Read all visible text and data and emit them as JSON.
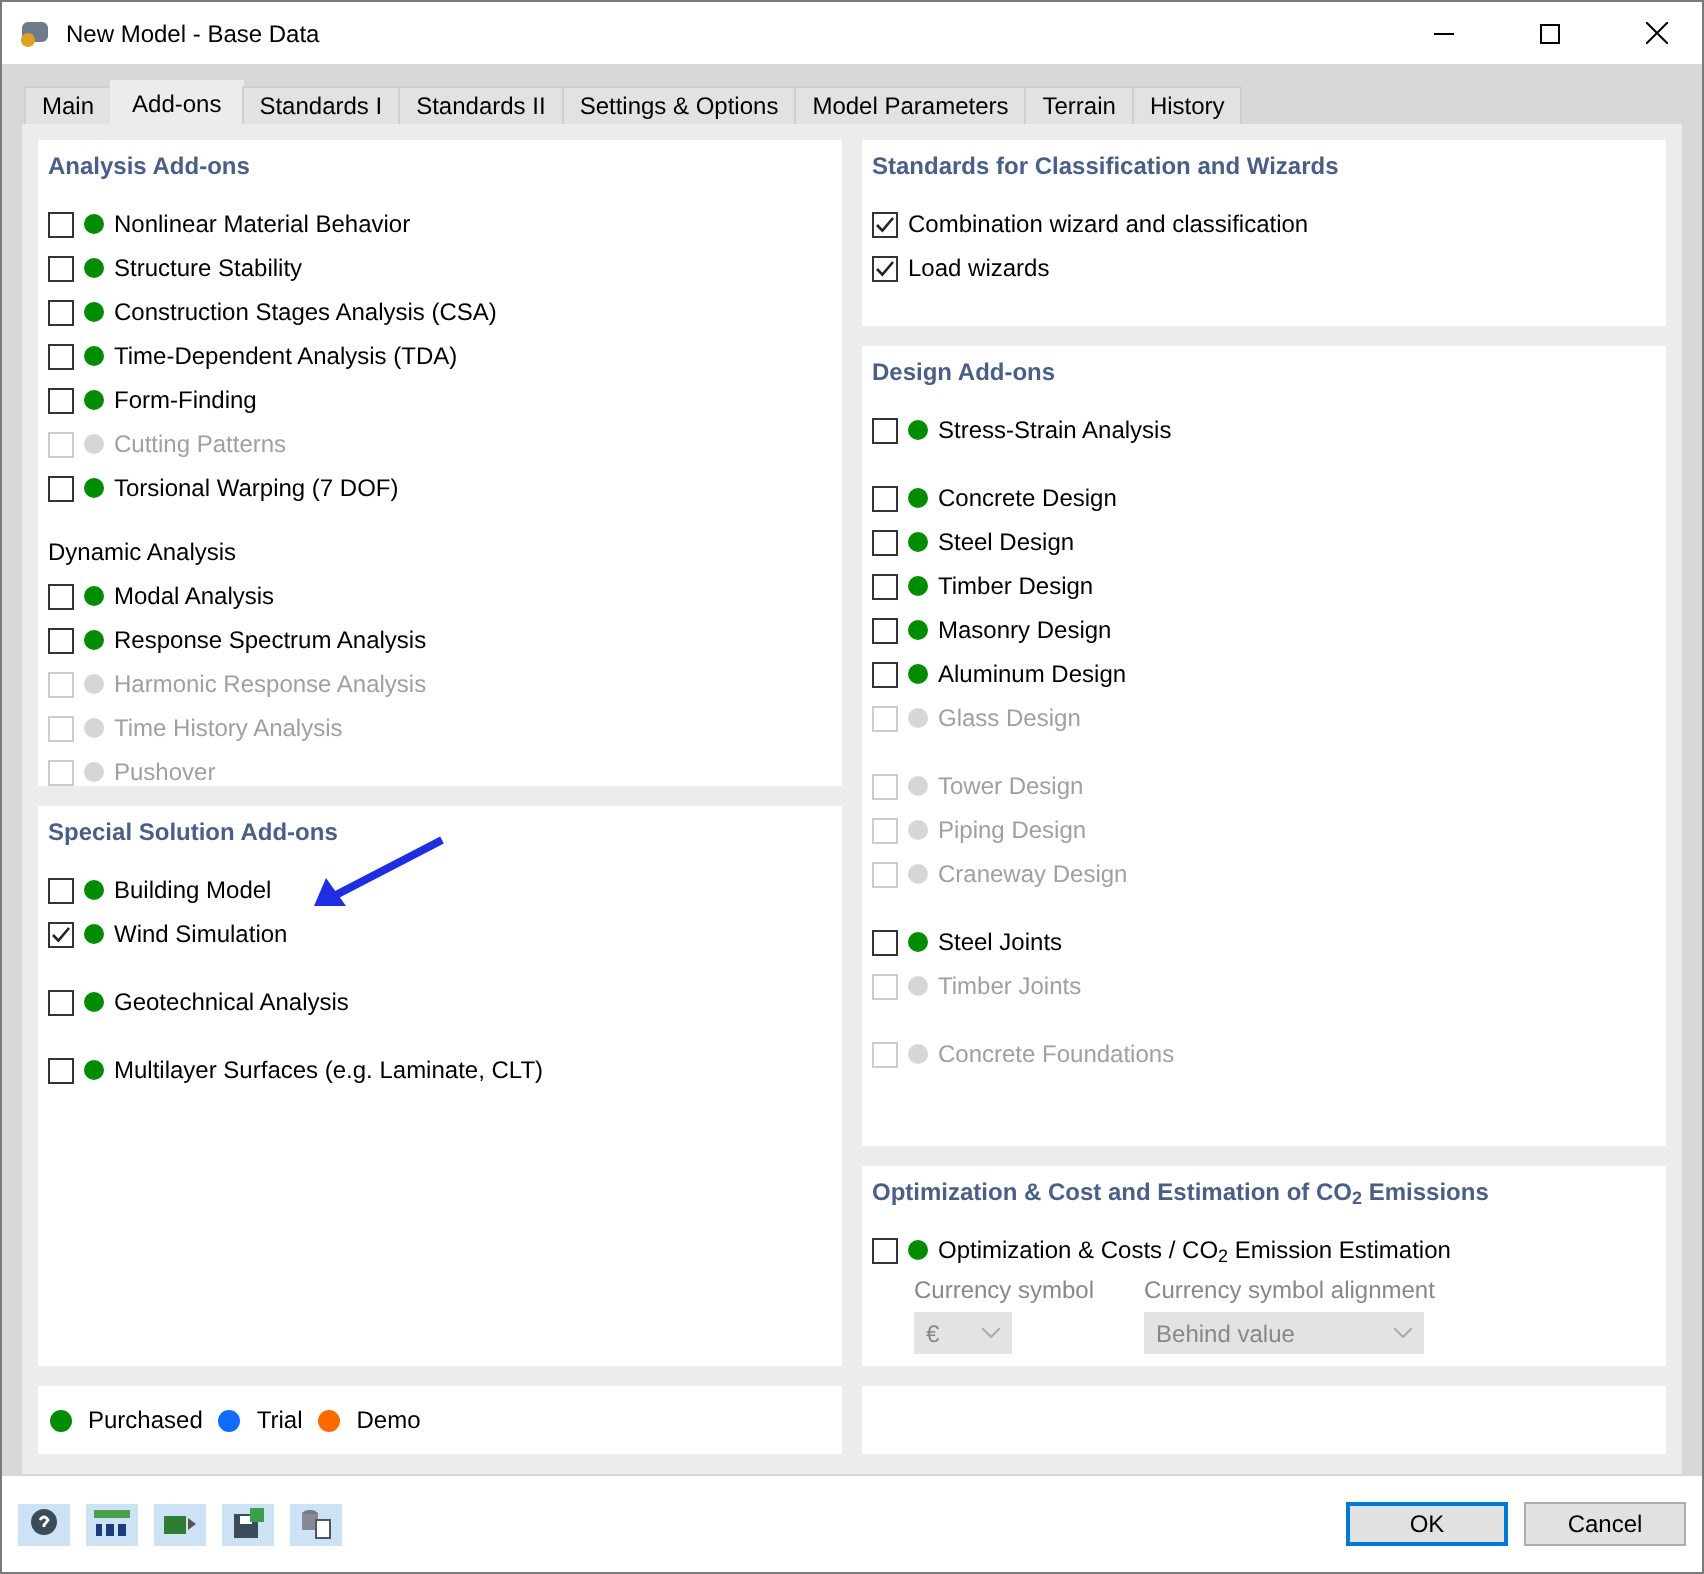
{
  "window": {
    "title": "New Model - Base Data"
  },
  "tabs": [
    {
      "label": "Main",
      "selected": false
    },
    {
      "label": "Add-ons",
      "selected": true
    },
    {
      "label": "Standards I",
      "selected": false
    },
    {
      "label": "Standards II",
      "selected": false
    },
    {
      "label": "Settings & Options",
      "selected": false
    },
    {
      "label": "Model Parameters",
      "selected": false
    },
    {
      "label": "Terrain",
      "selected": false
    },
    {
      "label": "History",
      "selected": false
    }
  ],
  "left_panels": [
    {
      "title": "Analysis Add-ons",
      "groups": [
        {
          "items": [
            {
              "label": "Nonlinear Material Behavior",
              "checked": false,
              "disabled": false,
              "color": "#008c00"
            },
            {
              "label": "Structure Stability",
              "checked": false,
              "disabled": false,
              "color": "#008c00"
            },
            {
              "label": "Construction Stages Analysis (CSA)",
              "checked": false,
              "disabled": false,
              "color": "#008c00"
            },
            {
              "label": "Time-Dependent Analysis (TDA)",
              "checked": false,
              "disabled": false,
              "color": "#008c00"
            },
            {
              "label": "Form-Finding",
              "checked": false,
              "disabled": false,
              "color": "#008c00"
            },
            {
              "label": "Cutting Patterns",
              "checked": false,
              "disabled": true,
              "color": "#d6d6d6"
            },
            {
              "label": "Torsional Warping (7 DOF)",
              "checked": false,
              "disabled": false,
              "color": "#008c00"
            }
          ]
        },
        {
          "heading": "Dynamic Analysis",
          "items": [
            {
              "label": "Modal Analysis",
              "checked": false,
              "disabled": false,
              "color": "#008c00"
            },
            {
              "label": "Response Spectrum Analysis",
              "checked": false,
              "disabled": false,
              "color": "#008c00"
            },
            {
              "label": "Harmonic Response Analysis",
              "checked": false,
              "disabled": true,
              "color": "#d6d6d6"
            },
            {
              "label": "Time History Analysis",
              "checked": false,
              "disabled": true,
              "color": "#d6d6d6"
            },
            {
              "label": "Pushover",
              "checked": false,
              "disabled": true,
              "color": "#d6d6d6"
            }
          ]
        }
      ]
    },
    {
      "title": "Special Solution Add-ons",
      "groups": [
        {
          "items": [
            {
              "label": "Building Model",
              "checked": false,
              "disabled": false,
              "color": "#008c00"
            },
            {
              "label": "Wind Simulation",
              "checked": true,
              "disabled": false,
              "color": "#008c00"
            }
          ]
        },
        {
          "items": [
            {
              "label": "Geotechnical Analysis",
              "checked": false,
              "disabled": false,
              "color": "#008c00"
            }
          ]
        },
        {
          "items": [
            {
              "label": "Multilayer Surfaces (e.g. Laminate, CLT)",
              "checked": false,
              "disabled": false,
              "color": "#008c00"
            }
          ]
        }
      ]
    }
  ],
  "legend": [
    {
      "label": "Purchased",
      "color": "#008c00"
    },
    {
      "label": "Trial",
      "color": "#0f6cff"
    },
    {
      "label": "Demo",
      "color": "#ff6a00"
    }
  ],
  "right_panels": [
    {
      "title": "Standards for Classification and Wizards",
      "groups": [
        {
          "items": [
            {
              "label": "Combination wizard and classification",
              "checked": true,
              "disabled": false
            },
            {
              "label": "Load wizards",
              "checked": true,
              "disabled": false
            }
          ]
        }
      ]
    },
    {
      "title": "Design Add-ons",
      "groups": [
        {
          "items": [
            {
              "label": "Stress-Strain Analysis",
              "checked": false,
              "disabled": false,
              "color": "#008c00"
            }
          ]
        },
        {
          "items": [
            {
              "label": "Concrete Design",
              "checked": false,
              "disabled": false,
              "color": "#008c00"
            },
            {
              "label": "Steel Design",
              "checked": false,
              "disabled": false,
              "color": "#008c00"
            },
            {
              "label": "Timber Design",
              "checked": false,
              "disabled": false,
              "color": "#008c00"
            },
            {
              "label": "Masonry Design",
              "checked": false,
              "disabled": false,
              "color": "#008c00"
            },
            {
              "label": "Aluminum Design",
              "checked": false,
              "disabled": false,
              "color": "#008c00"
            },
            {
              "label": "Glass Design",
              "checked": false,
              "disabled": true,
              "color": "#d6d6d6"
            }
          ]
        },
        {
          "items": [
            {
              "label": "Tower Design",
              "checked": false,
              "disabled": true,
              "color": "#d6d6d6"
            },
            {
              "label": "Piping Design",
              "checked": false,
              "disabled": true,
              "color": "#d6d6d6"
            },
            {
              "label": "Craneway Design",
              "checked": false,
              "disabled": true,
              "color": "#d6d6d6"
            }
          ]
        },
        {
          "items": [
            {
              "label": "Steel Joints",
              "checked": false,
              "disabled": false,
              "color": "#008c00"
            },
            {
              "label": "Timber Joints",
              "checked": false,
              "disabled": true,
              "color": "#d6d6d6"
            }
          ]
        },
        {
          "items": [
            {
              "label": "Concrete Foundations",
              "checked": false,
              "disabled": true,
              "color": "#d6d6d6"
            }
          ]
        }
      ]
    }
  ],
  "optimization": {
    "title": "Optimization & Cost and Estimation of CO$_{2}$ Emissions",
    "item": {
      "label": "Optimization & Costs / CO$_{2}$ Emission Estimation",
      "checked": false,
      "disabled": false,
      "color": "#008c00"
    },
    "fields": [
      {
        "label": "Currency symbol",
        "value": "€",
        "disabled": true
      },
      {
        "label": "Currency symbol alignment",
        "value": "Behind value",
        "disabled": true
      }
    ]
  },
  "buttons": [
    {
      "label": "OK",
      "default": true
    },
    {
      "label": "Cancel",
      "default": false
    }
  ]
}
